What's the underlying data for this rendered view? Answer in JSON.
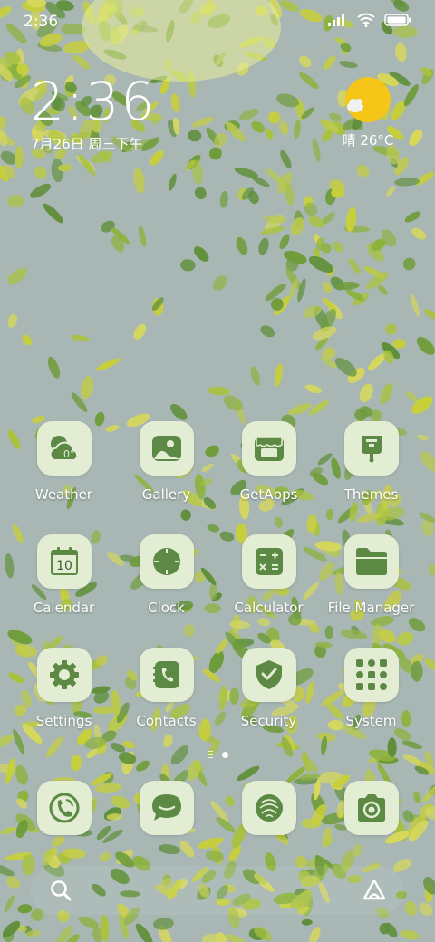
{
  "status_bar": {
    "time": "2:36",
    "icons": [
      "signal-icon",
      "wifi-icon",
      "battery-icon"
    ]
  },
  "clock_widget": {
    "time": "2:36",
    "date": "7月26日 周三下午"
  },
  "weather_widget": {
    "icon": "sun-cloud-icon",
    "text": "晴 26°C"
  },
  "apps": [
    {
      "label": "Weather",
      "icon": "weather-icon",
      "badge": "0°"
    },
    {
      "label": "Gallery",
      "icon": "gallery-icon"
    },
    {
      "label": "GetApps",
      "icon": "getapps-icon"
    },
    {
      "label": "Themes",
      "icon": "themes-icon"
    },
    {
      "label": "Calendar",
      "icon": "calendar-icon",
      "badge": "10"
    },
    {
      "label": "Clock",
      "icon": "clock-icon"
    },
    {
      "label": "Calculator",
      "icon": "calculator-icon"
    },
    {
      "label": "File Manager",
      "icon": "folder-icon"
    },
    {
      "label": "Settings",
      "icon": "settings-icon"
    },
    {
      "label": "Contacts",
      "icon": "contacts-icon"
    },
    {
      "label": "Security",
      "icon": "shield-icon"
    },
    {
      "label": "System",
      "icon": "system-folder-icon"
    }
  ],
  "dock": [
    {
      "icon": "phone-icon"
    },
    {
      "icon": "messages-icon"
    },
    {
      "icon": "browser-icon"
    },
    {
      "icon": "camera-icon"
    }
  ],
  "pager": {
    "pages": 1,
    "current": 1
  },
  "bottom_bar": {
    "left_icon": "search-icon",
    "right_icon": "assistant-icon"
  },
  "colors": {
    "icon_bg": "#e3edd4",
    "icon_fg": "#5c8a45",
    "sun": "#f5c518",
    "sky": "#a8b7b4",
    "leaf_light": "#c7cf3a",
    "leaf_dark": "#5f8f3a"
  }
}
